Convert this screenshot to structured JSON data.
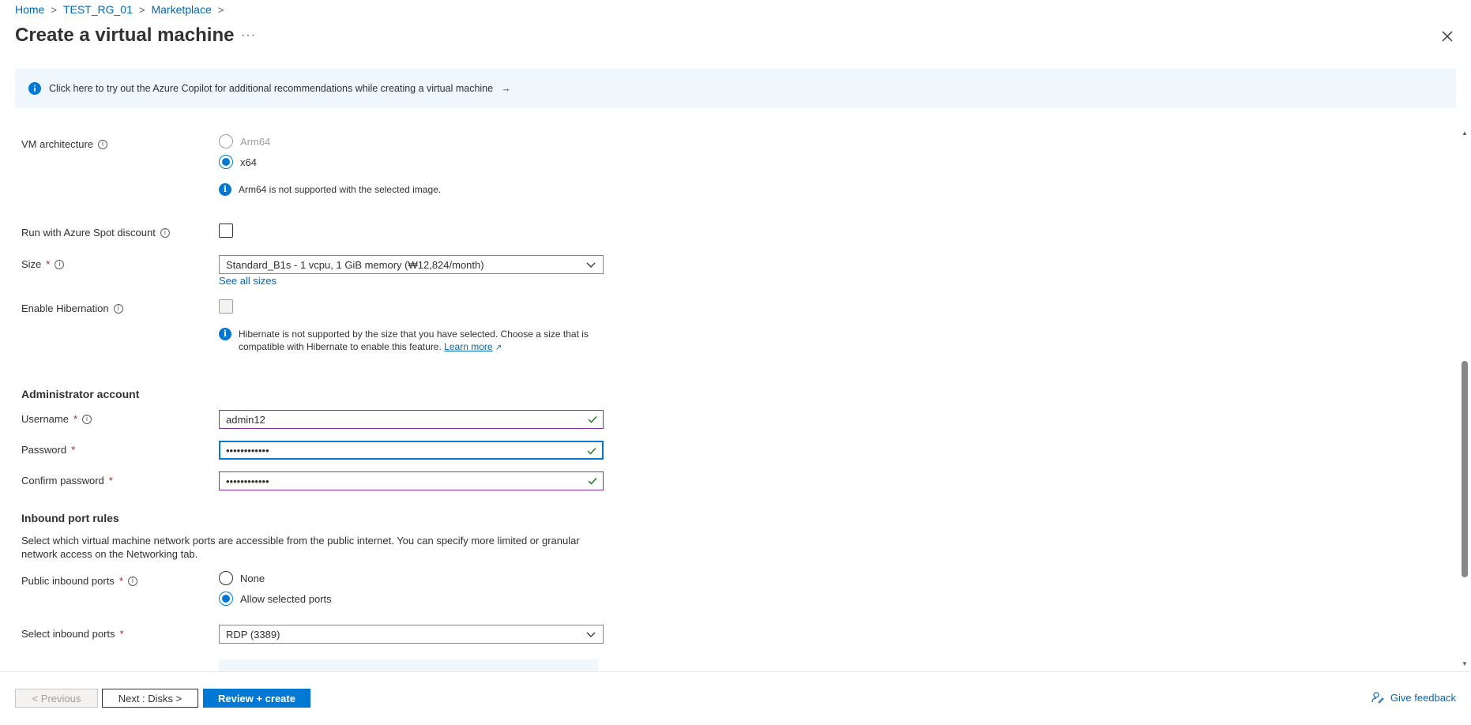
{
  "breadcrumb": {
    "items": [
      "Home",
      "TEST_RG_01",
      "Marketplace"
    ],
    "separator": ">"
  },
  "page": {
    "title": "Create a virtual machine",
    "more": "···",
    "close_icon": "close-icon"
  },
  "banner": {
    "text": "Click here to try out the Azure Copilot for additional recommendations while creating a virtual machine",
    "arrow": "→"
  },
  "vm_architecture": {
    "label": "VM architecture",
    "options": [
      {
        "label": "Arm64",
        "selected": false,
        "disabled": true
      },
      {
        "label": "x64",
        "selected": true
      }
    ],
    "note": "Arm64 is not supported with the selected image."
  },
  "spot": {
    "label": "Run with Azure Spot discount",
    "checked": false
  },
  "size": {
    "label": "Size",
    "required": "*",
    "value": "Standard_B1s - 1 vcpu, 1 GiB memory (₩12,824/month)",
    "see_all": "See all sizes"
  },
  "hibernation": {
    "label": "Enable Hibernation",
    "checked": false,
    "note_line1": "Hibernate is not supported by the size that you have selected. Choose a size that is",
    "note_line2": "compatible with Hibernate to enable this feature.",
    "learn_more": "Learn more"
  },
  "admin": {
    "heading": "Administrator account",
    "username_label": "Username",
    "username_value": "admin12",
    "password_label": "Password",
    "password_value": "••••••••••••",
    "confirm_label": "Confirm password",
    "confirm_value": "••••••••••••",
    "required": "*"
  },
  "inbound": {
    "heading": "Inbound port rules",
    "description": "Select which virtual machine network ports are accessible from the public internet. You can specify more limited or granular network access on the Networking tab.",
    "public_label": "Public inbound ports",
    "options": [
      {
        "label": "None",
        "selected": false
      },
      {
        "label": "Allow selected ports",
        "selected": true
      }
    ],
    "select_label": "Select inbound ports",
    "select_value": "RDP (3389)",
    "required": "*"
  },
  "footer": {
    "previous": "< Previous",
    "next": "Next : Disks >",
    "review": "Review + create",
    "feedback": "Give feedback"
  },
  "colors": {
    "accent": "#0078d4",
    "link": "#0067b8",
    "banner_bg": "#eff6fc",
    "required": "#a4262c",
    "valid_border": "#8a2da5",
    "valid_check": "#107c10"
  }
}
